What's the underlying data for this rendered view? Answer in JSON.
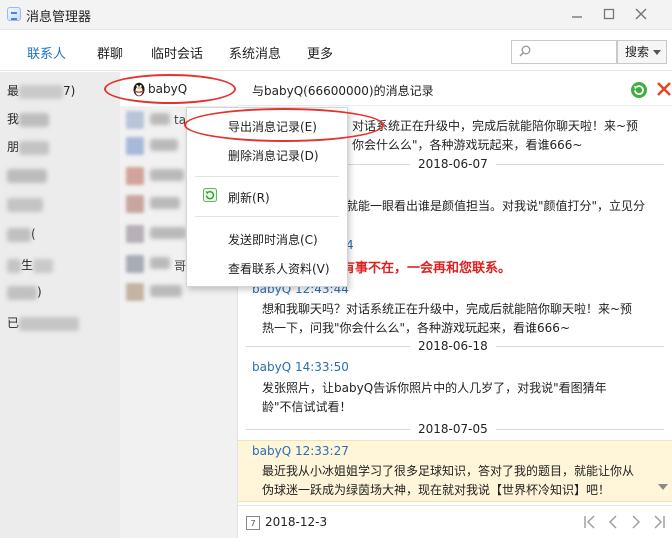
{
  "window": {
    "title": "消息管理器",
    "controls": [
      "minimize-icon",
      "restore-icon",
      "close-icon"
    ]
  },
  "nav": {
    "tabs": [
      {
        "label": "联系人",
        "active": true
      },
      {
        "label": "群聊",
        "active": false
      },
      {
        "label": "临时会话",
        "active": false
      },
      {
        "label": "系统消息",
        "active": false
      },
      {
        "label": "更多",
        "active": false
      }
    ],
    "search_placeholder": "",
    "search_button": "搜索"
  },
  "left_panel": {
    "items": [
      "最",
      "7)",
      "我",
      "朋",
      "(",
      "生",
      ")",
      "已"
    ]
  },
  "middle_panel": {
    "selected_contact": "babyQ",
    "partial_texts": [
      "tao",
      "哥"
    ]
  },
  "record": {
    "title": "与babyQ(66600000)的消息记录"
  },
  "messages": [
    {
      "sender": "",
      "time": "",
      "text": "对话系统正在升级中，完成后就能陪你聊天啦！来~预",
      "text2": "你会什么么\"，各种游戏玩起来，看谁666~"
    },
    {
      "date": "2018-06-07"
    },
    {
      "sender": "",
      "time": "",
      "text": "就能一眼看出谁是颜值担当。对我说\"颜值打分\"，立见分"
    },
    {
      "sender": "",
      "time": "4",
      "text": "有事不在，一会再和您联系。",
      "emphasis": true
    },
    {
      "sender": "babyQ",
      "time": "12:43:44",
      "text": "想和我聊天吗？对话系统正在升级中，完成后就能陪你聊天啦！来~预",
      "text2": "热一下，问我\"你会什么么\"，各种游戏玩起来，看谁666~"
    },
    {
      "date": "2018-06-18"
    },
    {
      "sender": "babyQ",
      "time": "14:33:50",
      "text": "发张照片，让babyQ告诉你照片中的人几岁了，对我说\"看图猜年",
      "text2": "龄\"不信试试看！"
    },
    {
      "date": "2018-07-05"
    },
    {
      "sender": "babyQ",
      "time": "12:33:27",
      "text": "最近我从小冰姐姐学习了很多足球知识，答对了我的题目，就能让你从",
      "text2": "伪球迷一跃成为绿茵场大神，现在就对我说【世界杯冷知识】吧！",
      "highlighted": true
    }
  ],
  "bottom_bar": {
    "date": "2018-12-3",
    "calendar_label": "7",
    "pager_icons": [
      "first-page-icon",
      "prev-page-icon",
      "next-page-icon",
      "last-page-icon"
    ]
  },
  "context_menu": {
    "items": [
      {
        "label": "导出消息记录(E)",
        "highlighted": true
      },
      {
        "label": "删除消息记录(D)"
      },
      {
        "label": "刷新(R)",
        "icon": "refresh-icon"
      },
      {
        "label": "发送即时消息(C)"
      },
      {
        "label": "查看联系人资料(V)"
      }
    ]
  },
  "colors": {
    "accent": "#1e73c9",
    "sender": "#2a6fb4",
    "annotation": "#e5322d",
    "highlight_bg": "#fff5d8",
    "emphasis_text": "#e02020"
  }
}
